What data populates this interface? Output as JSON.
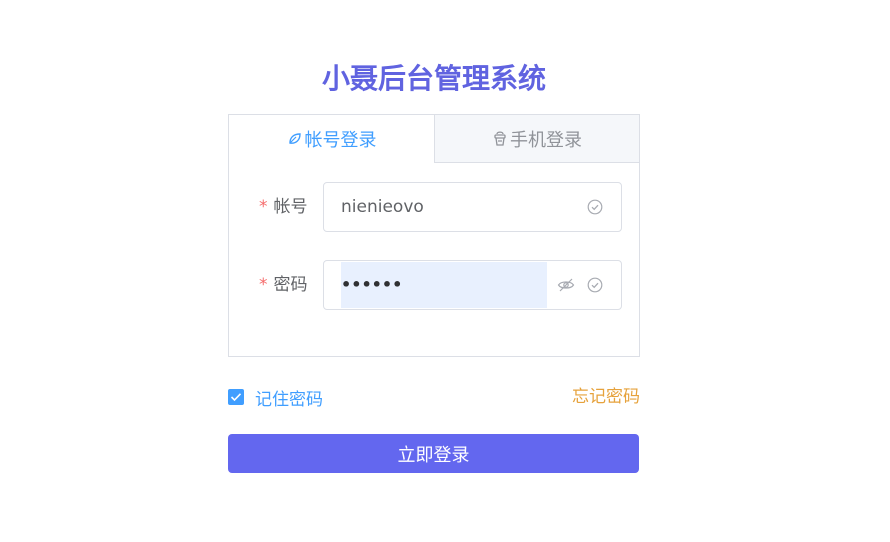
{
  "title": "小聂后台管理系统",
  "tabs": [
    {
      "label": "帐号登录",
      "icon": "leaf-icon",
      "active": true
    },
    {
      "label": "手机登录",
      "icon": "basket-icon",
      "active": false
    }
  ],
  "form": {
    "account": {
      "required_mark": "*",
      "label": "帐号",
      "value": "nienieovo"
    },
    "password": {
      "required_mark": "*",
      "label": "密码",
      "value": "••••••"
    }
  },
  "remember": {
    "label": "记住密码",
    "checked": true
  },
  "forgot_label": "忘记密码",
  "login_button": "立即登录",
  "colors": {
    "title": "#6063e0",
    "active_tab": "#409eff",
    "required": "#f56c6c",
    "forgot": "#e6a23c",
    "button": "#6367ef"
  }
}
